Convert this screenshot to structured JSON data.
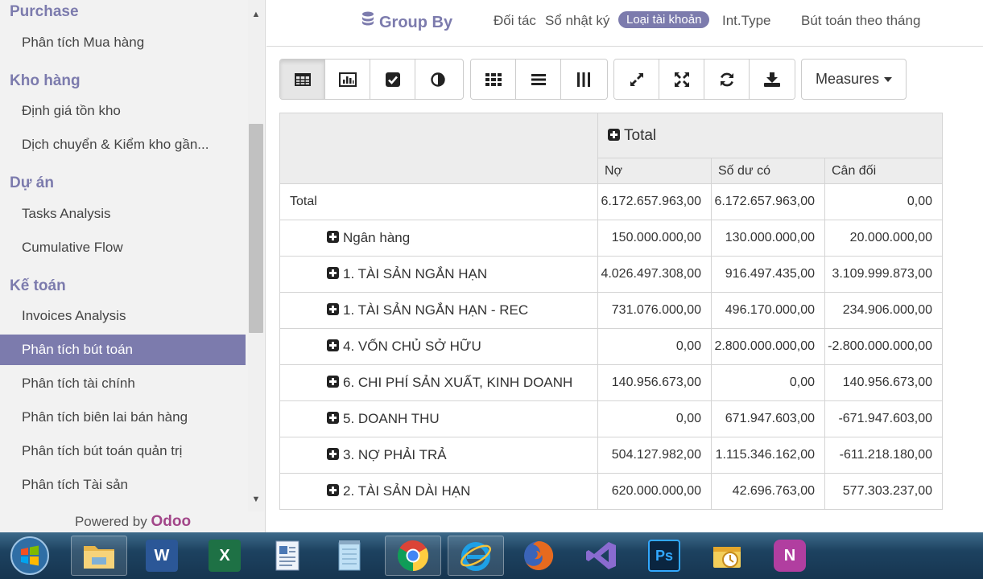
{
  "sidebar": {
    "sections": [
      {
        "title": "Purchase",
        "items": [
          "Phân tích Mua hàng"
        ]
      },
      {
        "title": "Kho hàng",
        "items": [
          "Định giá tồn kho",
          "Dịch chuyển & Kiểm kho gần..."
        ]
      },
      {
        "title": "Dự án",
        "items": [
          "Tasks Analysis",
          "Cumulative Flow"
        ]
      },
      {
        "title": "Kế toán",
        "items": [
          "Invoices Analysis",
          "Phân tích bút toán",
          "Phân tích tài chính",
          "Phân tích biên lai bán hàng",
          "Phân tích bút toán quản trị",
          "Phân tích Tài sản"
        ]
      }
    ],
    "active_item": "Phân tích bút toán",
    "powered_by": "Powered by",
    "powered_brand": "Odoo"
  },
  "groupby": {
    "title": "Group By",
    "options": [
      "Đối tác",
      "Sổ nhật ký",
      "Loại tài khoản",
      "Int.Type",
      "Bút toán theo tháng"
    ],
    "selected": "Loại tài khoản"
  },
  "toolbar": {
    "measures_label": "Measures"
  },
  "pivot": {
    "col_group": "Total",
    "columns": [
      "Nợ",
      "Số dư có",
      "Cân đối"
    ],
    "total_row": {
      "label": "Total",
      "values": [
        "6.172.657.963,00",
        "6.172.657.963,00",
        "0,00"
      ]
    },
    "rows": [
      {
        "label": "Ngân hàng",
        "values": [
          "150.000.000,00",
          "130.000.000,00",
          "20.000.000,00"
        ]
      },
      {
        "label": "1. TÀI SẢN NGẮN HẠN",
        "values": [
          "4.026.497.308,00",
          "916.497.435,00",
          "3.109.999.873,00"
        ]
      },
      {
        "label": "1. TÀI SẢN NGẮN HẠN - REC",
        "values": [
          "731.076.000,00",
          "496.170.000,00",
          "234.906.000,00"
        ]
      },
      {
        "label": "4. VỐN CHỦ SỞ HỮU",
        "values": [
          "0,00",
          "2.800.000.000,00",
          "-2.800.000.000,00"
        ]
      },
      {
        "label": "6. CHI PHÍ SẢN XUẤT, KINH DOANH",
        "values": [
          "140.956.673,00",
          "0,00",
          "140.956.673,00"
        ]
      },
      {
        "label": "5. DOANH THU",
        "values": [
          "0,00",
          "671.947.603,00",
          "-671.947.603,00"
        ]
      },
      {
        "label": "3. NỢ PHẢI TRẢ",
        "values": [
          "504.127.982,00",
          "1.115.346.162,00",
          "-611.218.180,00"
        ]
      },
      {
        "label": "2. TÀI SẢN DÀI HẠN",
        "values": [
          "620.000.000,00",
          "42.696.763,00",
          "577.303.237,00"
        ]
      }
    ]
  },
  "taskbar": {
    "apps": [
      "start-orb",
      "file-explorer",
      "word",
      "excel",
      "notepad-doc",
      "notepad",
      "chrome",
      "internet-explorer",
      "firefox",
      "visual-studio",
      "photoshop",
      "outlook",
      "onenote"
    ]
  }
}
